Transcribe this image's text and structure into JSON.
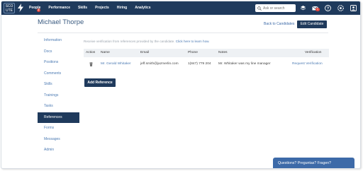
{
  "nav": {
    "logo_text": "SCO\nUTE",
    "items": [
      {
        "label": "People",
        "badge": "2"
      },
      {
        "label": "Performance"
      },
      {
        "label": "Skills"
      },
      {
        "label": "Projects"
      },
      {
        "label": "Hiring"
      },
      {
        "label": "Analytics"
      }
    ],
    "search_placeholder": "Ask or search",
    "mail_badge": "1",
    "brand_color": "#1f3a5c",
    "badge_color": "#e2453c"
  },
  "header": {
    "title": "Michael Thorpe",
    "back_link": "Back to Candidates",
    "edit_button": "Edit Candidate"
  },
  "sidebar": {
    "items": [
      {
        "label": "Information",
        "active": false
      },
      {
        "label": "Docs",
        "active": false
      },
      {
        "label": "Positions",
        "active": false
      },
      {
        "label": "Comments",
        "active": false
      },
      {
        "label": "Skills",
        "active": false
      },
      {
        "label": "Trainings",
        "active": false
      },
      {
        "label": "Tasks",
        "active": false
      },
      {
        "label": "References",
        "active": true
      },
      {
        "label": "Forms",
        "active": false
      },
      {
        "label": "Messages",
        "active": false
      },
      {
        "label": "Admin",
        "active": false
      }
    ]
  },
  "main": {
    "info_text": "Receive verification from references provided by the candidate. ",
    "info_link": "Click here to learn how.",
    "table": {
      "headers": [
        "Action",
        "Name",
        "Email",
        "Phone",
        "Notes",
        "Verification"
      ],
      "rows": [
        {
          "name": "Mr. Gerald Whitaker",
          "email": "jeff.smith@jazmerlin.com",
          "phone": "1(847) 779 204",
          "notes": "Mr. Whitaker was my line manager",
          "verification": "Request Verification"
        }
      ]
    },
    "add_button": "Add Reference"
  },
  "chat": {
    "label": "Questions? Preguntas? Fragen?"
  }
}
